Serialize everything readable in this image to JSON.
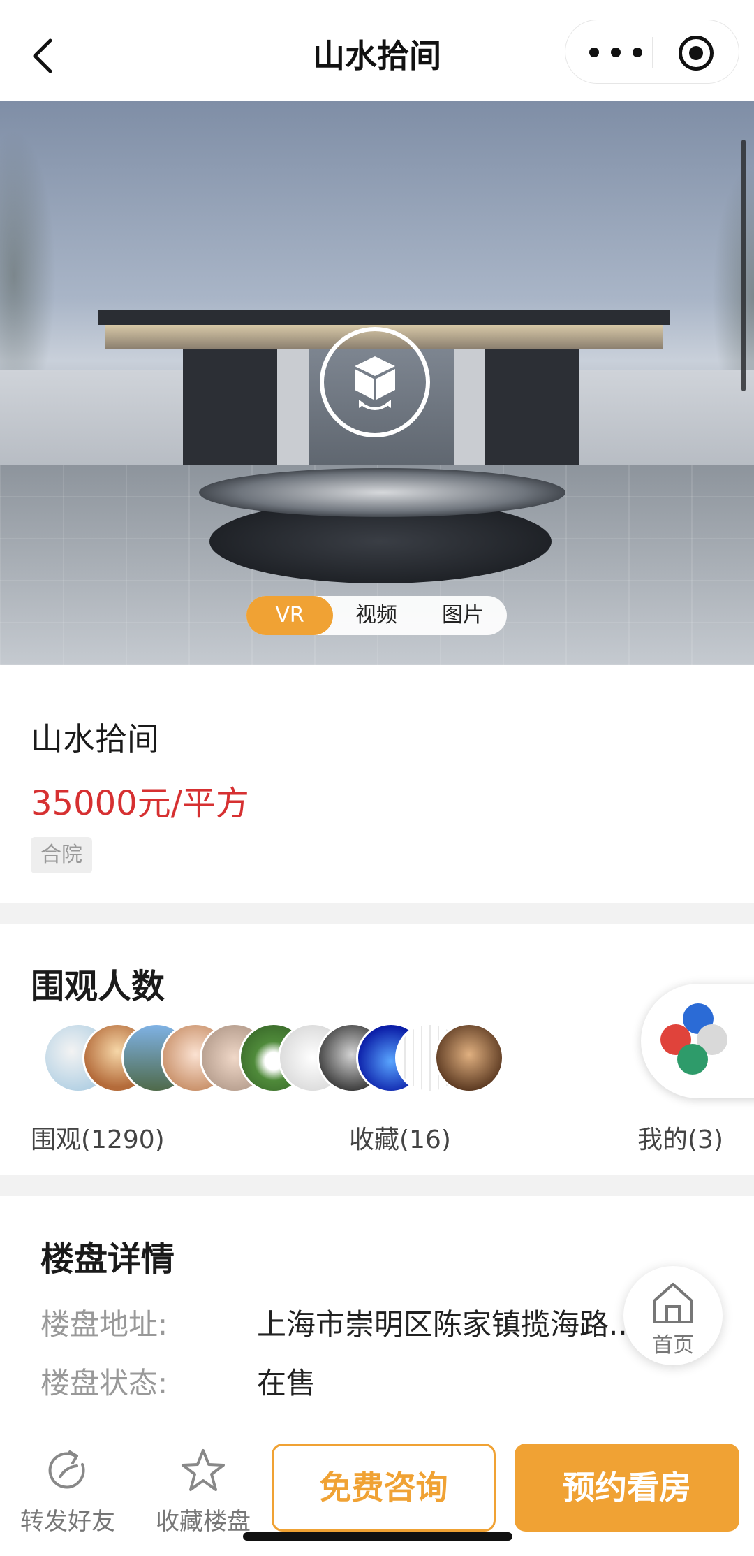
{
  "nav": {
    "title": "山水拾间",
    "back_icon": "chevron-left-icon",
    "more_icon": "more-dots-icon",
    "target_icon": "target-icon"
  },
  "hero": {
    "vr_icon": "vr-cube-icon",
    "media_tabs": [
      {
        "label": "VR",
        "active": true
      },
      {
        "label": "视频",
        "active": false
      },
      {
        "label": "图片",
        "active": false
      }
    ]
  },
  "info": {
    "name": "山水拾间",
    "price": "35000元/平方",
    "tag": "合院"
  },
  "viewers": {
    "title": "围观人数",
    "avatar_count_shown": 11,
    "stats": {
      "views": "围观(1290)",
      "favorites": "收藏(16)",
      "mine": "我的(3)"
    }
  },
  "detail": {
    "title": "楼盘详情",
    "rows": [
      {
        "label": "楼盘地址:",
        "value": "上海市崇明区陈家镇揽海路..."
      },
      {
        "label": "楼盘状态:",
        "value": "在售"
      }
    ]
  },
  "home_float": {
    "label": "首页",
    "icon": "home-icon"
  },
  "bottom_bar": {
    "share_label": "转发好友",
    "share_icon": "share-refresh-icon",
    "fav_label": "收藏楼盘",
    "fav_icon": "star-icon",
    "consult_label": "免费咨询",
    "book_label": "预约看房"
  },
  "colors": {
    "accent": "#f0a234",
    "price": "#d63031"
  }
}
